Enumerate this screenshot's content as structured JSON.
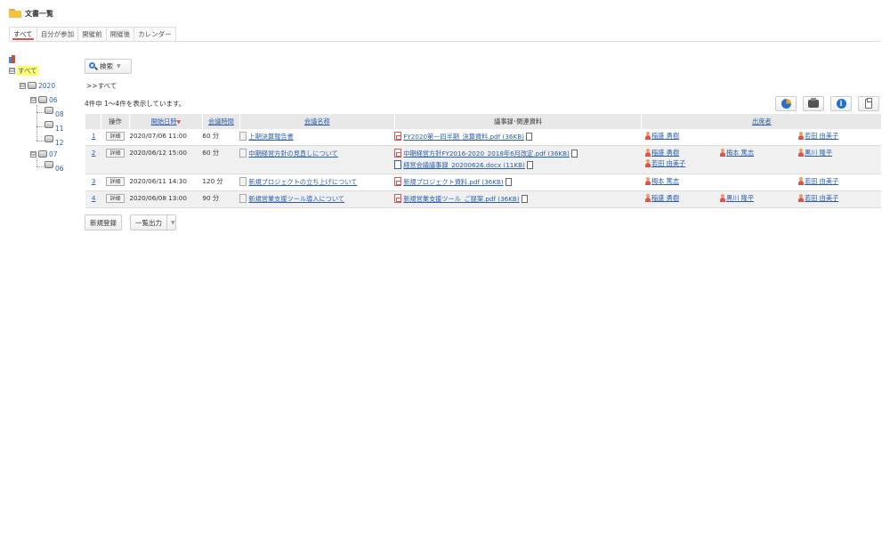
{
  "header": {
    "title": "文書一覧",
    "icon": "folder-icon"
  },
  "tabs": [
    {
      "label": "すべて",
      "active": true
    },
    {
      "label": "自分が参加",
      "active": false
    },
    {
      "label": "開催前",
      "active": false
    },
    {
      "label": "開催後",
      "active": false
    },
    {
      "label": "カレンダー",
      "active": false
    }
  ],
  "tree": {
    "root": "すべて",
    "year": "2020",
    "months": [
      {
        "label": "06",
        "toggle": "⊟",
        "days": [
          "08",
          "11",
          "12"
        ]
      },
      {
        "label": "07",
        "toggle": "⊟",
        "days": [
          "06"
        ]
      }
    ],
    "toggle_symbol": "⊟"
  },
  "search": {
    "label": "検索",
    "caret": "▼"
  },
  "breadcrumb": ">>すべて",
  "result_count": "4件中 1〜4件を表示しています。",
  "toolbar_icons": [
    "chart-icon",
    "print-icon",
    "info-icon",
    "clipboard-icon"
  ],
  "info_glyph": "i",
  "table": {
    "headers": {
      "operation": "操作",
      "start": "開始日時",
      "sort_marker": "▼",
      "duration": "会議時間",
      "name": "会議名称",
      "files": "議事録･関連資料",
      "attendees": "出席者"
    },
    "rows": [
      {
        "no": "1",
        "detail": "詳細",
        "start": "2020/07/06 11:00",
        "duration": "60 分",
        "name": "上期決算報告書",
        "files": [
          {
            "type": "pdf",
            "name": "FY2020第一四半期_決算資料.pdf (36KB)"
          }
        ],
        "attendees": [
          "稲盛 勇樹",
          "",
          "若田 由美子"
        ]
      },
      {
        "no": "2",
        "detail": "詳細",
        "start": "2020/06/12 15:00",
        "duration": "60 分",
        "name": "中期経営方針の見直しについて",
        "files": [
          {
            "type": "pdf",
            "name": "中期経営方針FY2016-2020_2018年6月改定.pdf (36KB)"
          },
          {
            "type": "word",
            "name": "経営会議議事録_20200626.docx (11KB)"
          }
        ],
        "attendees": [
          "稲盛 勇樹",
          "梅本 篤志",
          "黒川 隆平",
          "若田 由美子"
        ]
      },
      {
        "no": "3",
        "detail": "詳細",
        "start": "2020/06/11 14:30",
        "duration": "120 分",
        "name": "新規プロジェクトの立ち上げについて",
        "files": [
          {
            "type": "pdf",
            "name": "新規プロジェクト資料.pdf (36KB)"
          }
        ],
        "attendees": [
          "梅本 篤志",
          "",
          "若田 由美子"
        ]
      },
      {
        "no": "4",
        "detail": "詳細",
        "start": "2020/06/08 13:00",
        "duration": "90 分",
        "name": "新規営業支援ツール導入について",
        "files": [
          {
            "type": "pdf",
            "name": "新規営業支援ツール_ご提案.pdf (36KB)"
          }
        ],
        "attendees": [
          "稲盛 勇樹",
          "黒川 隆平",
          "若田 由美子"
        ]
      }
    ]
  },
  "actions": {
    "new": "新規登録",
    "export": "一覧出力",
    "export_caret": "▼"
  }
}
